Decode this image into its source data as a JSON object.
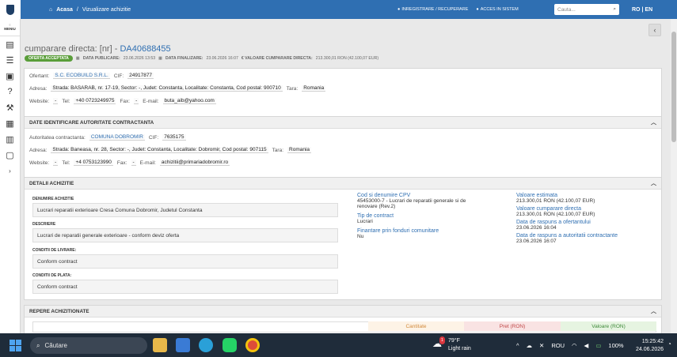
{
  "nav": {
    "home": "Acasa",
    "separator": "/",
    "current": "Vizualizare achizitie",
    "register": "INREGISTRARE / RECUPERARE",
    "access": "ACCES IN SISTEM",
    "search_placeholder": "Cauta...",
    "lang_ro": "RO",
    "lang_sep": "|",
    "lang_en": "EN"
  },
  "sidebar": {
    "menu_label": "MENIU",
    "icons": [
      "document-icon",
      "list-icon",
      "file-check-icon",
      "help-icon",
      "tools-icon",
      "report-icon",
      "table-icon",
      "chat-icon",
      "chevron-right-icon"
    ]
  },
  "header": {
    "title_prefix": "cumparare directa: [nr] - ",
    "title_code": "DA40688455",
    "badge": "OFERTA ACCEPTATA",
    "publish_label": "DATA PUBLICARE:",
    "publish_value": "23.06.2026 13:53",
    "final_label": "DATA FINALIZARE:",
    "final_value": "23.06.2026 16:07",
    "value_label": "€ VALOARE CUMPARARE DIRECTA:",
    "value_value": "213.300,01 RON (42.100,07 EUR)"
  },
  "offerer": {
    "offerer_label": "Ofertant:",
    "offerer_name": "S.C. ECOBUILD S.R.L.",
    "cif_label": "CIF:",
    "cif": "24917877",
    "address_label": "Adresa:",
    "address": "Strada: BASARAB, nr. 17-19, Sector: -, Judet: Constanta, Localitate: Constanta, Cod postal: 900710",
    "country_label": "Tara:",
    "country": "Romania",
    "website_label": "Website:",
    "website": "-",
    "tel_label": "Tel:",
    "tel": "+40 0723249975",
    "fax_label": "Fax:",
    "fax": "-",
    "email_label": "E-mail:",
    "email": "buta_aib@yahoo.com"
  },
  "authority": {
    "heading": "DATE IDENTIFICARE AUTORITATE CONTRACTANTA",
    "authority_label": "Autoritatea contractanta:",
    "authority_name": "COMUNA DOBROMIR",
    "cif_label": "CIF:",
    "cif": "7635175",
    "address_label": "Adresa:",
    "address": "Strada: Baneasa, nr. 28, Sector: -, Judet: Constanta, Localitate: Dobromir, Cod postal: 907115",
    "country_label": "Tara:",
    "country": "Romania",
    "website_label": "Website:",
    "website": "-",
    "tel_label": "Tel:",
    "tel": "+4 0753123990",
    "fax_label": "Fax:",
    "fax": "-",
    "email_label": "E-mail:",
    "email": "achizitii@primariadobromir.ro"
  },
  "details": {
    "heading": "DETALII ACHIZITIE",
    "name_label": "DENUMIRE ACHIZITIE",
    "name": "Lucrari reparatii exterioare Cresa Comuna Dobromir, Judetul Constanta",
    "desc_label": "DESCRIERE",
    "desc": "Lucrari de reparatii generale exterioare - conform deviz oferta",
    "delivery_label": "CONDITII DE LIVRARE:",
    "delivery": "Conform contract",
    "payment_label": "CONDITII DE PLATA:",
    "payment": "Conform contract",
    "cpv_label": "Cod si denumire CPV",
    "cpv_line1": "45453000-7 - Lucrari de reparatii generale si de",
    "cpv_line2": "renovare (Rev.2)",
    "contract_type_label": "Tip de contract",
    "contract_type": "Lucrari",
    "eu_funds_label": "Finantare prin fonduri comunitare",
    "eu_funds": "Nu",
    "est_value_label": "Valoare estimata",
    "est_value": "213.300,01   RON (42.100,07   EUR)",
    "buy_value_label": "Valoare cumparare directa",
    "buy_value": "213.300,01   RON (42.100,07   EUR)",
    "offer_reply_label": "Data de raspuns a ofertantului",
    "offer_reply": "23.06.2026 16:04",
    "auth_reply_label": "Data de raspuns a autoritatii contractante",
    "auth_reply": "23.06.2026 16:07"
  },
  "items": {
    "heading": "REPERE ACHIZITIONATE",
    "col_qty": "Cantitate",
    "col_price": "Pret (RON)",
    "col_value": "Valoare (RON)"
  },
  "taskbar": {
    "search": "Căutare",
    "weather_temp": "79°F",
    "weather_desc": "Light rain",
    "weather_badge": "1",
    "chevron": "^",
    "lang": "ROU",
    "battery": "100%",
    "time": "15:25:42",
    "date": "24.06.2026"
  }
}
